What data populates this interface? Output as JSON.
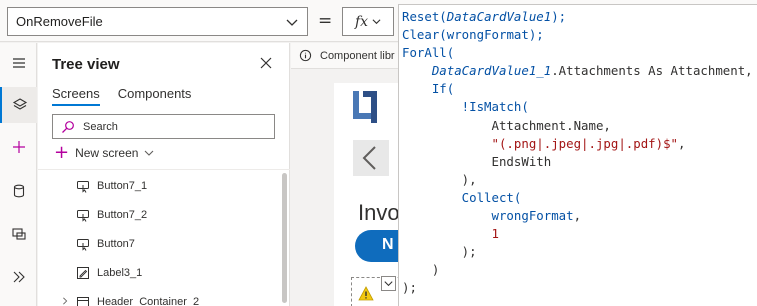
{
  "formula_bar": {
    "property": "OnRemoveFile",
    "equals": "=",
    "fx_label": "fx"
  },
  "code_lines": [
    [
      {
        "t": "Reset(",
        "c": "fn"
      },
      {
        "t": "DataCardValue1",
        "c": "var"
      },
      {
        "t": ");",
        "c": "fn"
      }
    ],
    [
      {
        "t": "Clear(",
        "c": "fn"
      },
      {
        "t": "wrongFormat",
        "c": "fn"
      },
      {
        "t": ");",
        "c": "fn"
      }
    ],
    [
      {
        "t": "ForAll(",
        "c": "fn"
      }
    ],
    [
      {
        "t": "    ",
        "c": "plain"
      },
      {
        "t": "DataCardValue1_1",
        "c": "var"
      },
      {
        "t": ".Attachments As Attachment,",
        "c": "plain"
      }
    ],
    [
      {
        "t": "    If(",
        "c": "fn"
      }
    ],
    [
      {
        "t": "        !IsMatch(",
        "c": "fn"
      }
    ],
    [
      {
        "t": "            Attachment.Name,",
        "c": "plain"
      }
    ],
    [
      {
        "t": "            \"(.png|.jpeg|.jpg|.pdf)$\"",
        "c": "str"
      },
      {
        "t": ",",
        "c": "plain"
      }
    ],
    [
      {
        "t": "            EndsWith",
        "c": "plain"
      }
    ],
    [
      {
        "t": "        ),",
        "c": "plain"
      }
    ],
    [
      {
        "t": "        Collect(",
        "c": "fn"
      }
    ],
    [
      {
        "t": "            wrongFormat",
        "c": "fn"
      },
      {
        "t": ",",
        "c": "plain"
      }
    ],
    [
      {
        "t": "            1",
        "c": "num"
      }
    ],
    [
      {
        "t": "        );",
        "c": "plain"
      }
    ],
    [
      {
        "t": "    )",
        "c": "plain"
      }
    ],
    [
      {
        "t": ");",
        "c": "plain"
      }
    ]
  ],
  "tree_view": {
    "title": "Tree view",
    "tabs": [
      "Screens",
      "Components"
    ],
    "active_tab": "Screens",
    "search_placeholder": "Search",
    "new_screen_label": "New screen",
    "items": [
      {
        "label": "Button7_1",
        "icon": "button-icon"
      },
      {
        "label": "Button7_2",
        "icon": "button-icon"
      },
      {
        "label": "Button7",
        "icon": "button-icon"
      },
      {
        "label": "Label3_1",
        "icon": "label-icon"
      },
      {
        "label": "Header_Container_2",
        "icon": "container-icon",
        "group": true
      }
    ]
  },
  "canvas": {
    "component_library_label": "Component libr",
    "heading_text": "Invo",
    "button_text": "N"
  },
  "colors": {
    "accent": "#0078d4",
    "code_blue": "#0451a5",
    "code_string": "#a31515",
    "new_screen_plus": "#b4009e",
    "canvas_button": "#0f6cbd"
  }
}
